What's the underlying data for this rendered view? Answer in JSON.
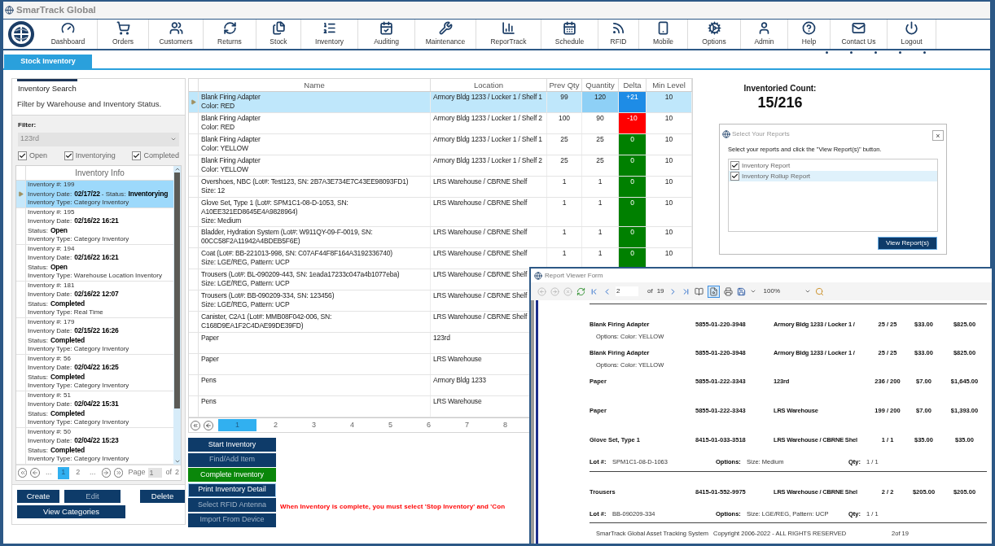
{
  "window": {
    "title": "SmarTrack Global"
  },
  "toolbar": [
    {
      "label": "Dashboard"
    },
    {
      "label": "Orders"
    },
    {
      "label": "Customers"
    },
    {
      "label": "Returns"
    },
    {
      "label": "Stock"
    },
    {
      "label": "Inventory"
    },
    {
      "label": "Auditing"
    },
    {
      "label": "Maintenance"
    },
    {
      "label": "ReporTrack"
    },
    {
      "label": "Schedule"
    },
    {
      "label": "RFID"
    },
    {
      "label": "Mobile"
    },
    {
      "label": "Options"
    },
    {
      "label": "Admin"
    },
    {
      "label": "Help"
    },
    {
      "label": "Contact Us"
    },
    {
      "label": "Logout"
    }
  ],
  "tabs": [
    {
      "label": "Stock Inventory",
      "selected": true
    }
  ],
  "inventory_search": {
    "tab": "Inventory Search",
    "description": "Filter by Warehouse and Inventory Status.",
    "filter_label": "Filter:",
    "filter_value": "123rd",
    "status_filters": [
      {
        "label": "Open",
        "checked": true
      },
      {
        "label": "Inventorying",
        "checked": true
      },
      {
        "label": "Completed",
        "checked": true
      }
    ],
    "list_header": "Inventory Info",
    "inventories": [
      {
        "kind": "compact",
        "selected": true,
        "number": "Inventory #: 199",
        "date_label": "Inventory Date:",
        "date": "02/17/22",
        "status_label": "- Status:",
        "status": "Inventorying",
        "type": "Inventory Type: Category Inventory"
      },
      {
        "kind": "full",
        "selected": false,
        "number": "Inventory #: 195",
        "date_label": "Inventory Date:",
        "date": "02/16/22 16:21",
        "status_label": "Status:",
        "status": "Open",
        "type": "Inventory Type: Category Inventory"
      },
      {
        "kind": "full",
        "selected": false,
        "number": "Inventory #: 194",
        "date_label": "Inventory Date:",
        "date": "02/16/22 16:21",
        "status_label": "Status:",
        "status": "Open",
        "type": "Inventory Type: Warehouse Location Inventory"
      },
      {
        "kind": "full",
        "selected": false,
        "number": "Inventory #: 181",
        "date_label": "Inventory Date:",
        "date": "02/16/22 12:07",
        "status_label": "Status:",
        "status": "Completed",
        "type": "Inventory Type: Real Time"
      },
      {
        "kind": "full",
        "selected": false,
        "number": "Inventory #: 179",
        "date_label": "Inventory Date:",
        "date": "02/15/22 16:26",
        "status_label": "Status:",
        "status": "Completed",
        "type": "Inventory Type: Category Inventory"
      },
      {
        "kind": "full",
        "selected": false,
        "number": "Inventory #: 56",
        "date_label": "Inventory Date:",
        "date": "02/04/22 16:25",
        "status_label": "Status:",
        "status": "Completed",
        "type": "Inventory Type: Category Inventory"
      },
      {
        "kind": "full",
        "selected": false,
        "number": "Inventory #: 51",
        "date_label": "Inventory Date:",
        "date": "02/04/22 15:31",
        "status_label": "Status:",
        "status": "Completed",
        "type": "Inventory Type: Category Inventory"
      },
      {
        "kind": "full",
        "selected": false,
        "number": "Inventory #: 50",
        "date_label": "Inventory Date:",
        "date": "02/04/22 15:23",
        "status_label": "Status:",
        "status": "Completed",
        "type": "Inventory Type: Category Inventory"
      }
    ],
    "pager": {
      "pages": [
        {
          "label": "...",
          "selected": false
        },
        {
          "label": "1",
          "selected": true
        },
        {
          "label": "2",
          "selected": false
        },
        {
          "label": "...",
          "selected": false
        }
      ],
      "page_label": "Page",
      "page_value": "1",
      "of_label": "of",
      "page_total": "2"
    },
    "buttons": [
      {
        "label": "Create",
        "disabled": false
      },
      {
        "label": "Edit",
        "disabled": true
      },
      {
        "label": "Delete",
        "disabled": false
      },
      {
        "label": "View Categories",
        "disabled": false
      }
    ]
  },
  "stock_table": {
    "columns": [
      "Name",
      "Location",
      "Prev Qty",
      "Quantity",
      "Delta",
      "Min Level"
    ],
    "rows": [
      {
        "selected": true,
        "name": "Blank Firing Adapter",
        "detail": "Color: RED",
        "location": "Armory Bldg 1233 / Locker 1 / Shelf 1",
        "prev_qty": "99",
        "quantity": "120",
        "delta": "+21",
        "color": "#1e8ce6",
        "min_level": "10"
      },
      {
        "selected": false,
        "name": "Blank Firing Adapter",
        "detail": "Color: RED",
        "location": "Armory Bldg 1233 / Locker 1 / Shelf 2",
        "prev_qty": "100",
        "quantity": "90",
        "delta": "-10",
        "color": "#ff0000",
        "min_level": "10"
      },
      {
        "selected": false,
        "name": "Blank Firing Adapter",
        "detail": "Color: YELLOW",
        "location": "Armory Bldg 1233 / Locker 1 / Shelf 1",
        "prev_qty": "25",
        "quantity": "25",
        "delta": "0",
        "color": "#008000",
        "min_level": "10"
      },
      {
        "selected": false,
        "name": "Blank Firing Adapter",
        "detail": "Color: YELLOW",
        "location": "Armory Bldg 1233 / Locker 1 / Shelf 2",
        "prev_qty": "25",
        "quantity": "25",
        "delta": "0",
        "color": "#008000",
        "min_level": "10"
      },
      {
        "selected": false,
        "name": "Overshoes, NBC (Lot#: Test123, SN: 2B7A3E734E7C43EE98093FD1)",
        "detail": "Size: 12",
        "location": "LRS Warehouse / CBRNE Shelf",
        "prev_qty": "1",
        "quantity": "1",
        "delta": "0",
        "color": "#008000",
        "min_level": "10"
      },
      {
        "selected": false,
        "name": "Glove Set, Type 1 (Lot#: SPM1C1-08-D-1053, SN: A10EE321ED8645E4A9828964)",
        "detail": "Size: Medium",
        "location": "LRS Warehouse / CBRNE Shelf",
        "prev_qty": "1",
        "quantity": "1",
        "delta": "0",
        "color": "#008000",
        "min_level": "10"
      },
      {
        "selected": false,
        "name": "Bladder, Hydration System (Lot#: W911QY-09-F-0019, SN: 00CC58F2A11942A4BDEB5F6E)",
        "location": "LRS Warehouse / CBRNE Shelf",
        "prev_qty": "1",
        "quantity": "1",
        "delta": "0",
        "color": "#008000",
        "min_level": "10"
      },
      {
        "selected": false,
        "name": "Coat (Lot#: BB-221013-998, SN: C07AF44F8F164A3192336740)",
        "detail": "Size: LGE/REG, Pattern: UCP",
        "location": "LRS Warehouse / CBRNE Shelf",
        "prev_qty": "1",
        "quantity": "1",
        "delta": "0",
        "color": "#008000",
        "min_level": "10"
      },
      {
        "selected": false,
        "name": "Trousers (Lot#: BL-090209-443, SN: 1eada17233c047a4b1077eba)",
        "detail": "Size: LGE/REG, Pattern: UCP",
        "location": "LRS Warehouse / CBRNE Shelf"
      },
      {
        "selected": false,
        "name": "Trousers (Lot#: BB-090209-334, SN: 123456)",
        "detail": "Size: LGE/REG, Pattern: UCP",
        "location": "LRS Warehouse / CBRNE Shelf"
      },
      {
        "selected": false,
        "name": "Canister, C2A1 (Lot#: MMB08F042-006, SN: C168D9EA1F2C4DAE99DE39FD)",
        "location": "LRS Warehouse / CBRNE Shelf"
      },
      {
        "selected": false,
        "name": "Paper",
        "location": "123rd"
      },
      {
        "selected": false,
        "name": "Paper",
        "location": "LRS Warehouse"
      },
      {
        "selected": false,
        "name": "Pens",
        "location": "Armory Bldg 1233"
      },
      {
        "selected": false,
        "name": "Pens",
        "location": "LRS Warehouse"
      }
    ],
    "pages": [
      {
        "label": "1",
        "selected": true
      },
      {
        "label": "2",
        "selected": false
      },
      {
        "label": "3",
        "selected": false
      },
      {
        "label": "4",
        "selected": false
      },
      {
        "label": "5",
        "selected": false
      },
      {
        "label": "6",
        "selected": false
      },
      {
        "label": "7",
        "selected": false
      },
      {
        "label": "8",
        "selected": false
      }
    ]
  },
  "actions": [
    {
      "label": "Start Inventory",
      "kind": "primary",
      "disabled": false,
      "focused": false
    },
    {
      "label": "Find/Add Item",
      "kind": "primary",
      "disabled": true,
      "focused": false
    },
    {
      "label": "Complete Inventory",
      "kind": "success",
      "disabled": false,
      "focused": false
    },
    {
      "label": "Print Inventory Detail",
      "kind": "primary",
      "disabled": false,
      "focused": true
    },
    {
      "label": "Select RFID Antenna",
      "kind": "primary",
      "disabled": true,
      "focused": false
    },
    {
      "label": "Import From Device",
      "kind": "primary",
      "disabled": true,
      "focused": false
    }
  ],
  "warning": "When Inventory is complete, you must select 'Stop Inventory' and 'Con",
  "count": {
    "label": "Inventoried Count:",
    "value": "15/216"
  },
  "report_dialog": {
    "title": "Select Your Reports",
    "close": "×",
    "instruction": "Select your reports and click the \"View Report(s)\" button.",
    "reports": [
      {
        "label": "Inventory Report",
        "checked": true,
        "selected": false
      },
      {
        "label": "Inventory Rollup Report",
        "checked": true,
        "selected": true
      }
    ],
    "button": "View Report(s)"
  },
  "report_viewer": {
    "title": "Report Viewer Form",
    "page_value": "2",
    "of_label": "of",
    "page_total": "19",
    "zoom": "100%",
    "entries": [
      {
        "name": "Blank Firing Adapter",
        "nsn": "5855-01-220-3948",
        "location": "Armory Bldg 1233 / Locker 1 /",
        "qty": "25 / 25",
        "price": "$33.00",
        "total": "$825.00",
        "options": "Options: Color: YELLOW"
      },
      {
        "name": "Blank Firing Adapter",
        "nsn": "5855-01-220-3948",
        "location": "Armory Bldg 1233 / Locker 1 /",
        "qty": "25 / 25",
        "price": "$33.00",
        "total": "$825.00",
        "options": "Options: Color: YELLOW"
      },
      {
        "name": "Paper",
        "nsn": "5855-01-222-3343",
        "location": "123rd",
        "qty": "236 / 200",
        "price": "$7.00",
        "total": "$1,645.00"
      },
      {
        "name": "Paper",
        "nsn": "5855-01-222-3343",
        "location": "LRS Warehouse",
        "qty": "199 / 200",
        "price": "$7.00",
        "total": "$1,393.00"
      },
      {
        "name": "Glove Set, Type 1",
        "nsn": "8415-01-033-3518",
        "location": "LRS Warehouse / CBRNE Shel",
        "qty": "1 / 1",
        "price": "$35.00",
        "total": "$35.00",
        "lot": {
          "label": "Lot #:",
          "value": "SPM1C1-08-D-1063",
          "options_label": "Options:",
          "options": "Size: Medium",
          "qty_label": "Qty:",
          "qty": "1 / 1"
        }
      },
      {
        "name": "Trousers",
        "nsn": "8415-01-552-9975",
        "location": "LRS Warehouse / CBRNE Shel",
        "qty": "2 / 2",
        "price": "$205.00",
        "total": "$205.00",
        "lot": {
          "label": "Lot #:",
          "value": "BB-090209-334",
          "options_label": "Options:",
          "options": "Size: LGE/REG, Pattern: UCP",
          "qty_label": "Qty:",
          "qty": "1 / 1"
        }
      }
    ],
    "footer_system": "SmarTrack Global Asset Tracking System",
    "footer_copyright": "Copyright 2006-2022 - ALL RIGHTS RESERVED",
    "page_info": "2of 19"
  }
}
